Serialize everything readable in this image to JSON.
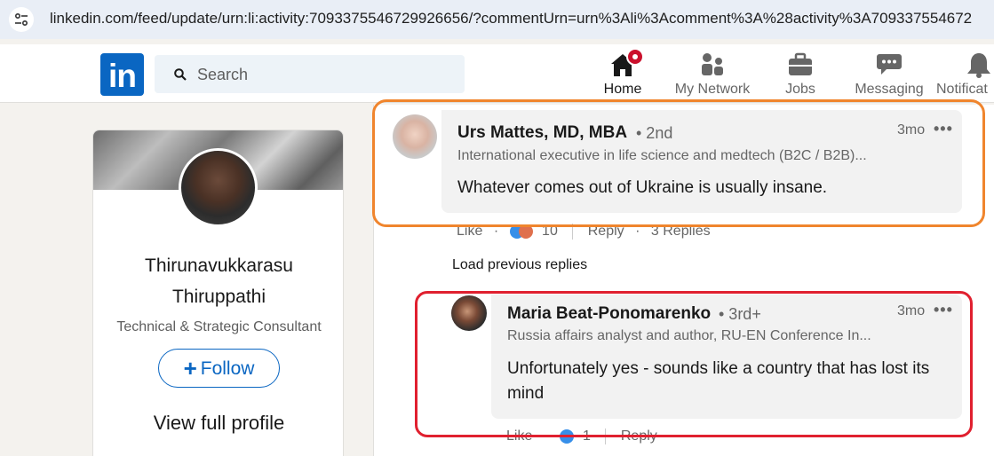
{
  "browser": {
    "url": "linkedin.com/feed/update/urn:li:activity:7093375546729926656/?commentUrn=urn%3Ali%3Acomment%3A%28activity%3A709337554672"
  },
  "nav": {
    "logo": "in",
    "search_placeholder": "Search",
    "items": [
      {
        "label": "Home",
        "icon": "home-icon"
      },
      {
        "label": "My Network",
        "icon": "network-icon"
      },
      {
        "label": "Jobs",
        "icon": "briefcase-icon"
      },
      {
        "label": "Messaging",
        "icon": "message-icon"
      },
      {
        "label": "Notificat",
        "icon": "bell-icon"
      }
    ]
  },
  "profile_card": {
    "name_line1": "Thirunavukkarasu",
    "name_line2": "Thiruppathi",
    "title": "Technical & Strategic Consultant",
    "follow_label": "Follow",
    "view_profile": "View full profile"
  },
  "comments": [
    {
      "author": "Urs Mattes, MD, MBA",
      "degree": "• 2nd",
      "headline": "International executive in life science and medtech (B2C / B2B)...",
      "text": "Whatever comes out of Ukraine is usually insane.",
      "time": "3mo",
      "more": "•••",
      "like_label": "Like",
      "reaction_count": "10",
      "reply_label": "Reply",
      "replies": "3 Replies"
    },
    {
      "author": "Maria Beat-Ponomarenko",
      "degree": "• 3rd+",
      "headline": "Russia affairs analyst and author, RU-EN Conference In...",
      "text": "Unfortunately yes - sounds like a country that has lost its mind",
      "time": "3mo",
      "more": "•••",
      "like_label": "Like",
      "reaction_count": "1",
      "reply_label": "Reply"
    }
  ],
  "load_previous": "Load previous replies",
  "colors": {
    "brand": "#0a66c2",
    "highlight_orange": "#f0852d",
    "highlight_red": "#e0202f",
    "notification_badge": "#cb112d"
  }
}
